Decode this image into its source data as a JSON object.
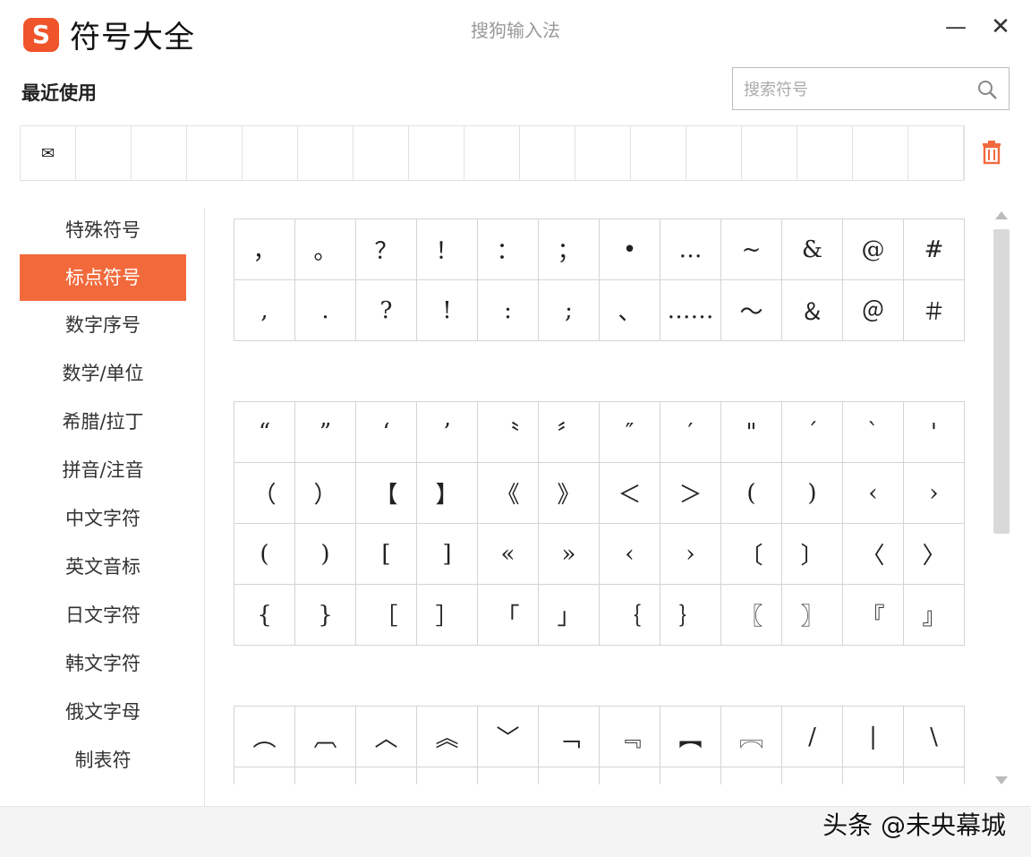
{
  "titlebar": {
    "logo_letter": "S",
    "app_title": "符号大全",
    "center_title": "搜狗输入法",
    "minimize_label": "—",
    "close_label": "✕"
  },
  "recent": {
    "label": "最近使用",
    "items": [
      "✉",
      "",
      "",
      "",
      "",
      "",
      "",
      "",
      "",
      "",
      "",
      "",
      "",
      "",
      "",
      "",
      "",
      ""
    ]
  },
  "search": {
    "placeholder": "搜索符号",
    "value": ""
  },
  "sidebar": {
    "items": [
      {
        "label": "特殊符号",
        "active": false
      },
      {
        "label": "标点符号",
        "active": true
      },
      {
        "label": "数字序号",
        "active": false
      },
      {
        "label": "数学/单位",
        "active": false
      },
      {
        "label": "希腊/拉丁",
        "active": false
      },
      {
        "label": "拼音/注音",
        "active": false
      },
      {
        "label": "中文字符",
        "active": false
      },
      {
        "label": "英文音标",
        "active": false
      },
      {
        "label": "日文字符",
        "active": false
      },
      {
        "label": "韩文字符",
        "active": false
      },
      {
        "label": "俄文字母",
        "active": false
      },
      {
        "label": "制表符",
        "active": false
      }
    ]
  },
  "groups": [
    [
      [
        "，",
        "。",
        "？",
        "！",
        "：",
        "；",
        "•",
        "…",
        "~",
        "&",
        "@",
        "#"
      ],
      [
        ",",
        ".",
        "?",
        "!",
        ":",
        ";",
        "、",
        "……",
        "～",
        "＆",
        "＠",
        "＃"
      ]
    ],
    [
      [
        "“",
        "”",
        "‘",
        "’",
        "〝",
        "〞",
        "″",
        "′",
        "\"",
        "ˊ",
        "ˋ",
        "'"
      ],
      [
        "（",
        "）",
        "【",
        "】",
        "《",
        "》",
        "＜",
        "＞",
        "(",
        ")",
        "‹",
        "›"
      ],
      [
        "(",
        ")",
        "[",
        "]",
        "«",
        "»",
        "‹",
        "›",
        "〔",
        "〕",
        "〈",
        "〉"
      ],
      [
        "{",
        "}",
        "［",
        "］",
        "「",
        "」",
        "｛",
        "｝",
        "〖",
        "〗",
        "『",
        "』"
      ]
    ],
    [
      [
        "︵",
        "︹",
        "︿",
        "︽",
        "﹀",
        "﹁",
        "﹃",
        "︻",
        "︗",
        "/",
        "|",
        "\\"
      ],
      [
        "︶",
        "︺",
        "﹀",
        "︾",
        "︿",
        "﹂",
        "﹄",
        "︼",
        "︘",
        "",
        "",
        ""
      ]
    ]
  ],
  "watermark": "头条 @未央幕城",
  "colors": {
    "accent": "#f26a3c",
    "logo": "#f0542a"
  }
}
